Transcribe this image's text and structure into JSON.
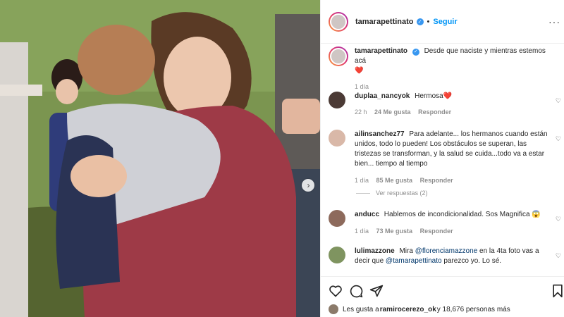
{
  "post": {
    "username": "tamarapettinato",
    "follow_label": "Seguir",
    "separator": "•",
    "more_label": "···",
    "caption": "Desde que naciste y mientras estemos acá",
    "caption_emoji": "❤️",
    "caption_time": "1 día"
  },
  "comments": [
    {
      "username": "duplaa_nancyok",
      "text": "Hermosa❤️",
      "time": "22 h",
      "likes": "24 Me gusta",
      "reply": "Responder"
    },
    {
      "username": "ailinsanchez77",
      "text": "Para adelante... los hermanos cuando están unidos, todo lo pueden! Los obstáculos se superan, las tristezas se transforman, y la salud se cuida...todo va a estar bien... tiempo al tiempo",
      "time": "1 día",
      "likes": "85 Me gusta",
      "reply": "Responder",
      "view_replies": "Ver respuestas (2)"
    },
    {
      "username": "anducc",
      "text": "Hablemos de incondicionalidad. Sos Magnifica 😱",
      "time": "1 día",
      "likes": "73 Me gusta",
      "reply": "Responder"
    },
    {
      "username": "lulimazzone",
      "text_before": "Mira ",
      "mention1": "@florenciamazzone",
      "text_mid": " en la 4ta foto vas a decir que ",
      "mention2": "@tamarapettinato",
      "text_after": " parezco yo. Lo sé."
    }
  ],
  "likes": {
    "prefix": "Les gusta a ",
    "user": "ramirocerezo_ok",
    "suffix": " y 18,676 personas más"
  },
  "icons": {
    "heart": "heart-icon",
    "comment": "comment-icon",
    "share": "share-icon",
    "save": "bookmark-icon",
    "next": "chevron-right-icon"
  },
  "colors": {
    "accent": "#0095f6",
    "verified": "#3897f0",
    "heart": "#ed4956"
  }
}
